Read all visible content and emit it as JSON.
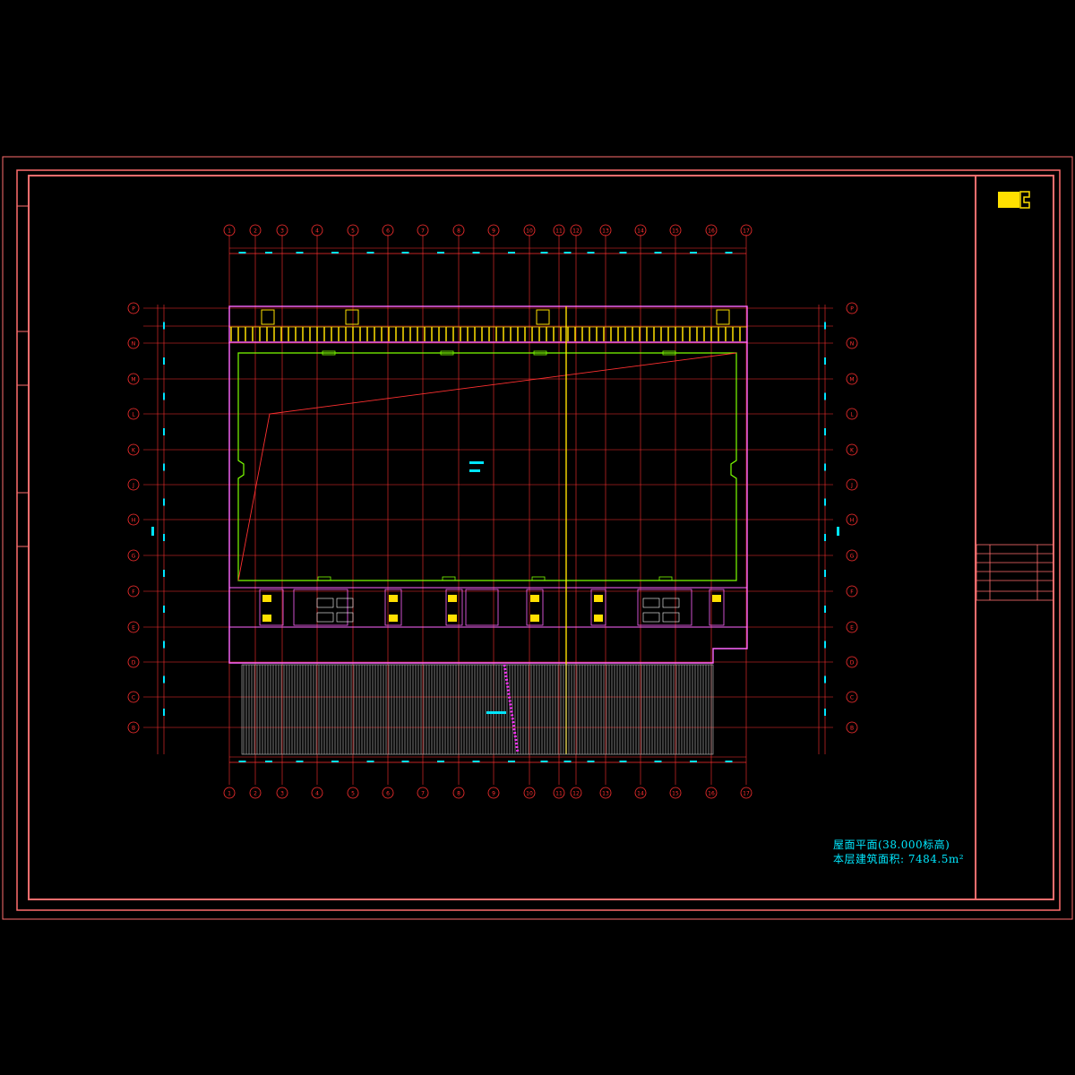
{
  "drawing": {
    "caption": "屋面平面(38.000标高)",
    "area_note": "本层建筑面积: 7484.5m²"
  },
  "grid": {
    "columns": [
      "1",
      "2",
      "3",
      "4",
      "5",
      "6",
      "7",
      "8",
      "9",
      "10",
      "11",
      "12",
      "13",
      "14",
      "15",
      "16",
      "17"
    ],
    "rows": [
      "P",
      "N",
      "M",
      "L",
      "K",
      "J",
      "H",
      "G",
      "F",
      "E",
      "D",
      "C",
      "B"
    ]
  },
  "colors": {
    "background": "#000000",
    "frame": "#ff6e6e",
    "grid": "#ff3030",
    "wall": "#ff66ff",
    "parapet": "#7cff00",
    "dimension": "#00e5ff",
    "highlight": "#ffe000",
    "louver": "#c9c9c9"
  }
}
